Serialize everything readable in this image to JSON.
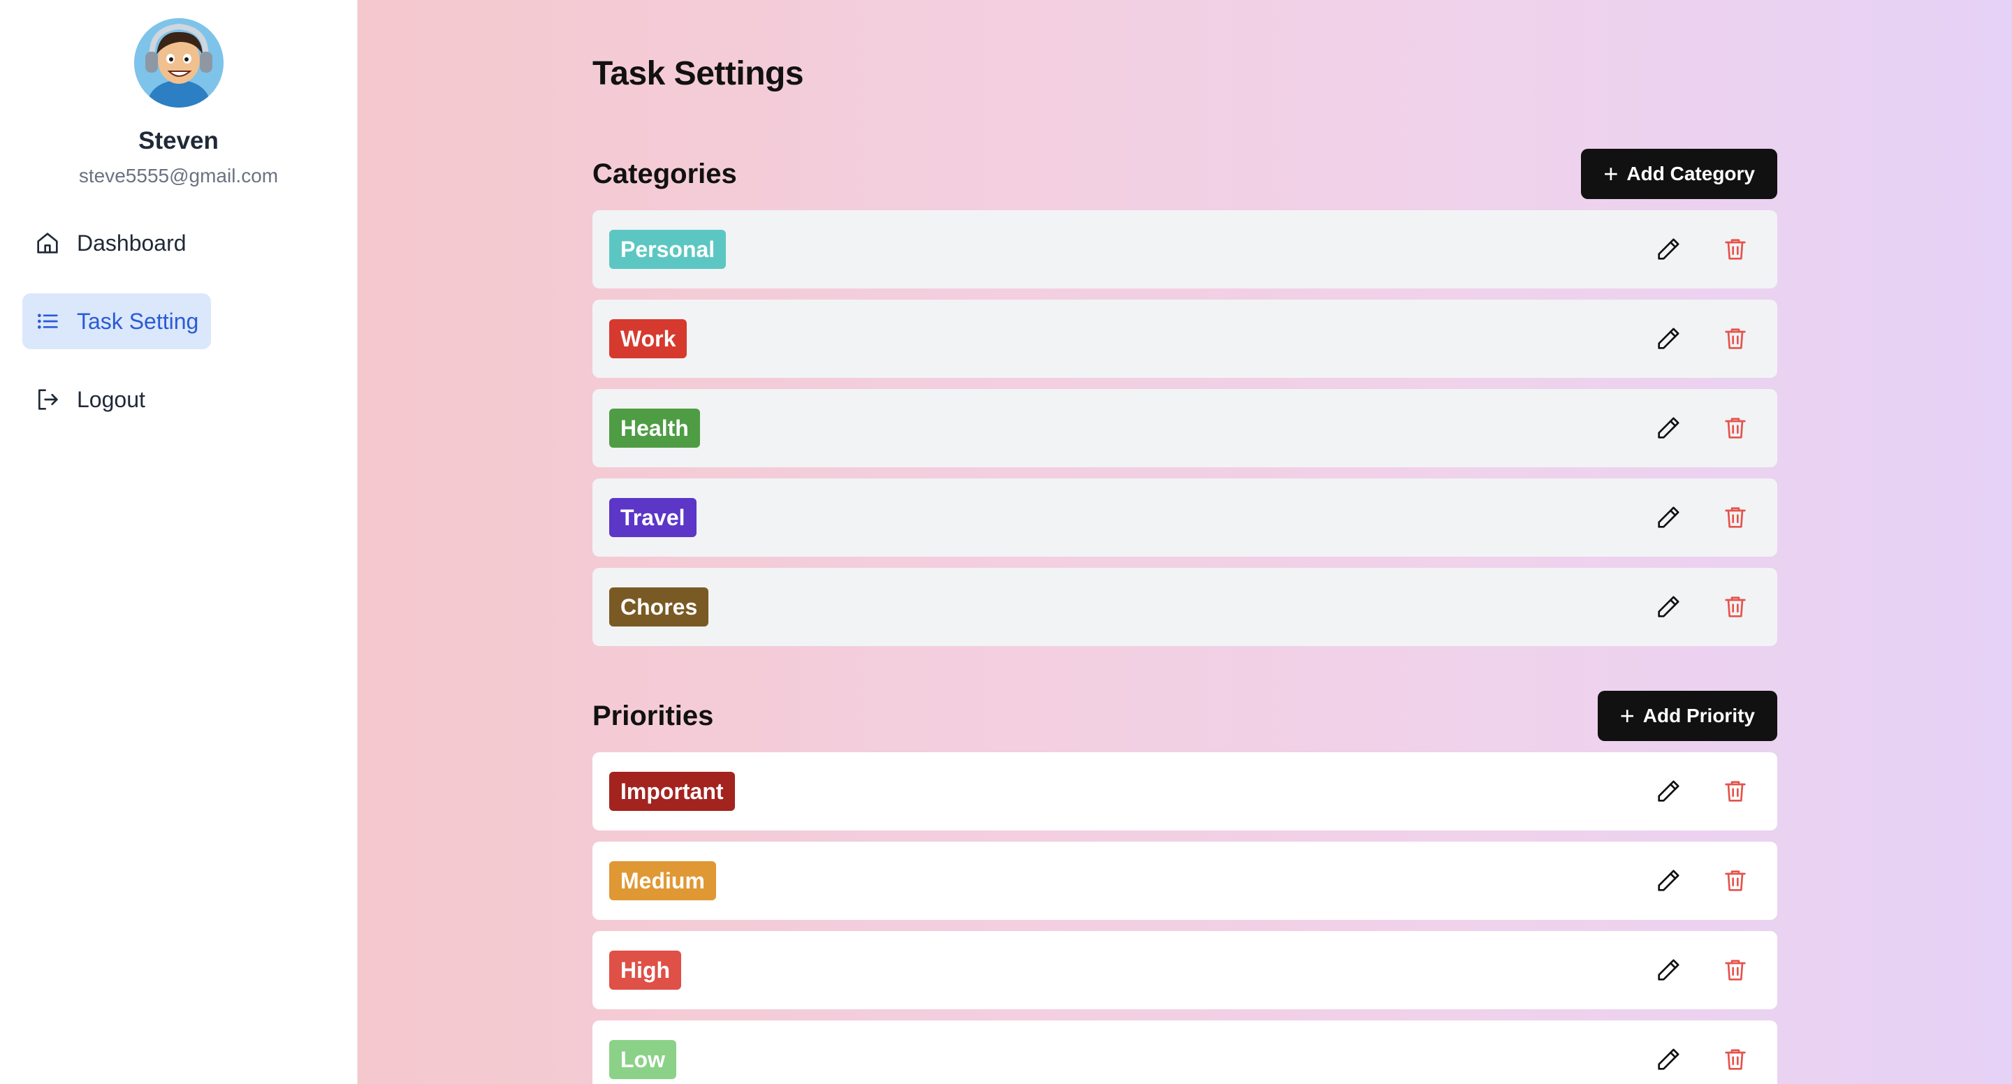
{
  "user": {
    "name": "Steven",
    "email": "steve5555@gmail.com"
  },
  "nav": {
    "items": [
      {
        "label": "Dashboard",
        "icon": "home-icon"
      },
      {
        "label": "Task Setting",
        "icon": "list-icon"
      },
      {
        "label": "Logout",
        "icon": "logout-icon"
      }
    ]
  },
  "page": {
    "title": "Task Settings"
  },
  "categories": {
    "title": "Categories",
    "add_label": "Add Category",
    "items": [
      {
        "label": "Personal",
        "color": "#5cc7c2"
      },
      {
        "label": "Work",
        "color": "#d63a2f"
      },
      {
        "label": "Health",
        "color": "#4e9d44"
      },
      {
        "label": "Travel",
        "color": "#5b36c7"
      },
      {
        "label": "Chores",
        "color": "#7a5a24"
      }
    ]
  },
  "priorities": {
    "title": "Priorities",
    "add_label": "Add Priority",
    "items": [
      {
        "label": "Important",
        "color": "#a3231f"
      },
      {
        "label": "Medium",
        "color": "#e09834"
      },
      {
        "label": "High",
        "color": "#df5047"
      },
      {
        "label": "Low",
        "color": "#8bd188"
      }
    ]
  },
  "colors": {
    "edit_icon": "#111111",
    "delete_icon": "#e5534b"
  }
}
